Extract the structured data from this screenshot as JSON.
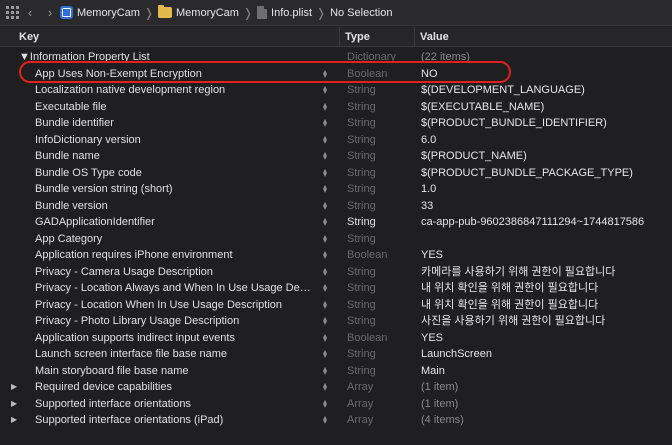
{
  "breadcrumb": {
    "items": [
      "MemoryCam",
      "MemoryCam",
      "Info.plist",
      "No Selection"
    ]
  },
  "columns": {
    "key": "Key",
    "type": "Type",
    "value": "Value"
  },
  "rows": [
    {
      "key": "▼Information Property List",
      "type": "Dictionary",
      "value": "(22 items)",
      "disclosure": "",
      "stepper": false,
      "type_dim": true,
      "value_dim": true
    },
    {
      "key": "App Uses Non-Exempt Encryption",
      "type": "Boolean",
      "value": "NO",
      "disclosure": "",
      "stepper": true,
      "type_dim": true,
      "value_dim": false
    },
    {
      "key": "Localization native development region",
      "type": "String",
      "value": "$(DEVELOPMENT_LANGUAGE)",
      "disclosure": "",
      "stepper": true,
      "type_dim": true,
      "value_dim": false
    },
    {
      "key": "Executable file",
      "type": "String",
      "value": "$(EXECUTABLE_NAME)",
      "disclosure": "",
      "stepper": true,
      "type_dim": true,
      "value_dim": false
    },
    {
      "key": "Bundle identifier",
      "type": "String",
      "value": "$(PRODUCT_BUNDLE_IDENTIFIER)",
      "disclosure": "",
      "stepper": true,
      "type_dim": true,
      "value_dim": false
    },
    {
      "key": "InfoDictionary version",
      "type": "String",
      "value": "6.0",
      "disclosure": "",
      "stepper": true,
      "type_dim": true,
      "value_dim": false
    },
    {
      "key": "Bundle name",
      "type": "String",
      "value": "$(PRODUCT_NAME)",
      "disclosure": "",
      "stepper": true,
      "type_dim": true,
      "value_dim": false
    },
    {
      "key": "Bundle OS Type code",
      "type": "String",
      "value": "$(PRODUCT_BUNDLE_PACKAGE_TYPE)",
      "disclosure": "",
      "stepper": true,
      "type_dim": true,
      "value_dim": false
    },
    {
      "key": "Bundle version string (short)",
      "type": "String",
      "value": "1.0",
      "disclosure": "",
      "stepper": true,
      "type_dim": true,
      "value_dim": false
    },
    {
      "key": "Bundle version",
      "type": "String",
      "value": "33",
      "disclosure": "",
      "stepper": true,
      "type_dim": true,
      "value_dim": false
    },
    {
      "key": "GADApplicationIdentifier",
      "type": "String",
      "value": "ca-app-pub-9602386847111294~1744817586",
      "disclosure": "",
      "stepper": true,
      "type_dim": false,
      "value_dim": false
    },
    {
      "key": "App Category",
      "type": "String",
      "value": "",
      "disclosure": "",
      "stepper": true,
      "type_dim": true,
      "value_dim": false
    },
    {
      "key": "Application requires iPhone environment",
      "type": "Boolean",
      "value": "YES",
      "disclosure": "",
      "stepper": true,
      "type_dim": true,
      "value_dim": false
    },
    {
      "key": "Privacy - Camera Usage Description",
      "type": "String",
      "value": "카메라를 사용하기 위해 권한이 필요합니다",
      "disclosure": "",
      "stepper": true,
      "type_dim": true,
      "value_dim": false
    },
    {
      "key": "Privacy - Location Always and When In Use Usage Descri...",
      "type": "String",
      "value": "내 위치 확인을 위해 권한이 필요합니다",
      "disclosure": "",
      "stepper": true,
      "type_dim": true,
      "value_dim": false
    },
    {
      "key": "Privacy - Location When In Use Usage Description",
      "type": "String",
      "value": "내 위치 확인을 위해 권한이 필요합니다",
      "disclosure": "",
      "stepper": true,
      "type_dim": true,
      "value_dim": false
    },
    {
      "key": "Privacy - Photo Library Usage Description",
      "type": "String",
      "value": "사진을 사용하기 위해 권한이 필요합니다",
      "disclosure": "",
      "stepper": true,
      "type_dim": true,
      "value_dim": false
    },
    {
      "key": "Application supports indirect input events",
      "type": "Boolean",
      "value": "YES",
      "disclosure": "",
      "stepper": true,
      "type_dim": true,
      "value_dim": false
    },
    {
      "key": "Launch screen interface file base name",
      "type": "String",
      "value": "LaunchScreen",
      "disclosure": "",
      "stepper": true,
      "type_dim": true,
      "value_dim": false
    },
    {
      "key": "Main storyboard file base name",
      "type": "String",
      "value": "Main",
      "disclosure": "",
      "stepper": true,
      "type_dim": true,
      "value_dim": false
    },
    {
      "key": "Required device capabilities",
      "type": "Array",
      "value": "(1 item)",
      "disclosure": "▶",
      "stepper": true,
      "type_dim": true,
      "value_dim": true
    },
    {
      "key": "Supported interface orientations",
      "type": "Array",
      "value": "(1 item)",
      "disclosure": "▶",
      "stepper": true,
      "type_dim": true,
      "value_dim": true
    },
    {
      "key": "Supported interface orientations (iPad)",
      "type": "Array",
      "value": "(4 items)",
      "disclosure": "▶",
      "stepper": true,
      "type_dim": true,
      "value_dim": true
    }
  ],
  "highlight_color": "#e3211c"
}
